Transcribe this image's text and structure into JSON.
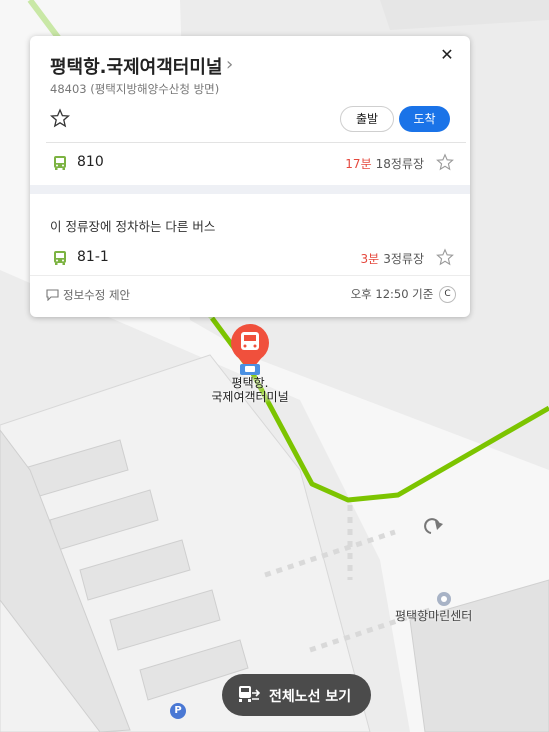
{
  "stop_card": {
    "title": "평택항.국제여객터미널",
    "subtitle": "48403 (평택지방해양수산청 방면)",
    "depart_label": "출발",
    "arrive_label": "도착",
    "routes": [
      {
        "number": "810",
        "eta_min": "17분",
        "stops_left": "18정류장"
      }
    ],
    "other_buses_heading": "이 정류장에 정차하는 다른 버스",
    "other_routes": [
      {
        "number": "81-1",
        "eta_min": "3분",
        "stops_left": "3정류장"
      }
    ],
    "suggest_edit_label": "정보수정 제안",
    "updated_time": "오후 12:50 기준"
  },
  "map": {
    "stop_marker_label_line1": "평택항.",
    "stop_marker_label_line2": "국제여객터미널",
    "poi_label": "평택항마린센터",
    "route_color": "#7cc400",
    "marker_color": "#f0503c"
  },
  "bottom": {
    "view_all_routes_label": "전체노선 보기"
  },
  "colors": {
    "primary": "#1a73e8",
    "eta_red": "#e5483d",
    "bus_green": "#7cb342"
  }
}
